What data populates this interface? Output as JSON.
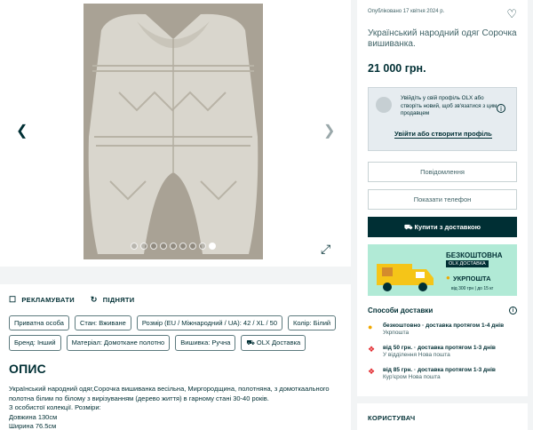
{
  "gallery": {
    "photo_alt": "",
    "dots_count": 8,
    "active_dot": 7
  },
  "actions": {
    "promote": "РЕКЛАМУВАТИ",
    "bump": "ПІДНЯТИ"
  },
  "tags": [
    "Приватна особа",
    "Стан: Вживане",
    "Розмір (EU / Міжнародний / UA): 42 / XL / 50",
    "Колір: Білий",
    "Бренд: Інший",
    "Матеріал: Домоткане полотно",
    "Вишивка: Ручна",
    "OLX Доставка"
  ],
  "description": {
    "title": "ОПИС",
    "lines": [
      "Український народний одяг,Сорочка вишиванка весільна, Миргородщина, полотняна, з домоткаального полотна білим по білому з вирізуванням (дерево життя) в гарному стані 30-40 років.",
      "З особистої колекції. Розміри:",
      "Довжина 130см",
      "Ширина 76.5см"
    ]
  },
  "listing": {
    "published": "Опубліковано 17 квітня 2024 р.",
    "title": "Український народний одяг Сорочка вишиванка.",
    "price": "21 000 грн."
  },
  "verify": {
    "text": "Увійдіть у свій профіль OLX або створіть новий, щоб зв'язатися з цим продавцем",
    "link": "Увійти або створити профіль"
  },
  "buttons": {
    "message": "Повідомлення",
    "phone": "Показати телефон",
    "buy": "Купити з доставкою"
  },
  "promo": {
    "free": "БЕЗКОШТОВНА",
    "olx_delivery": "OLX ДОСТАВКА",
    "carrier": "УКРПОШТА",
    "limit": "від 300 грн | до 15 кг"
  },
  "delivery": {
    "title": "Способи доставки",
    "options": [
      {
        "main": "безкоштовно · доставка протягом 1-4 днів",
        "sub": "Укрпошта",
        "color": "#f0a800"
      },
      {
        "main": "від 50 грн. · доставка протягом 1-3 днів",
        "sub": "У відділення Нова пошта",
        "color": "#e2262b"
      },
      {
        "main": "від 85 грн. · доставка протягом 1-3 днів",
        "sub": "Кур'єром Нова пошта",
        "color": "#e2262b"
      }
    ]
  },
  "user": {
    "heading": "КОРИСТУВАЧ"
  },
  "colors": {
    "dark": "#002f34",
    "muted": "#406367",
    "promo_bg": "#b1ead6"
  }
}
